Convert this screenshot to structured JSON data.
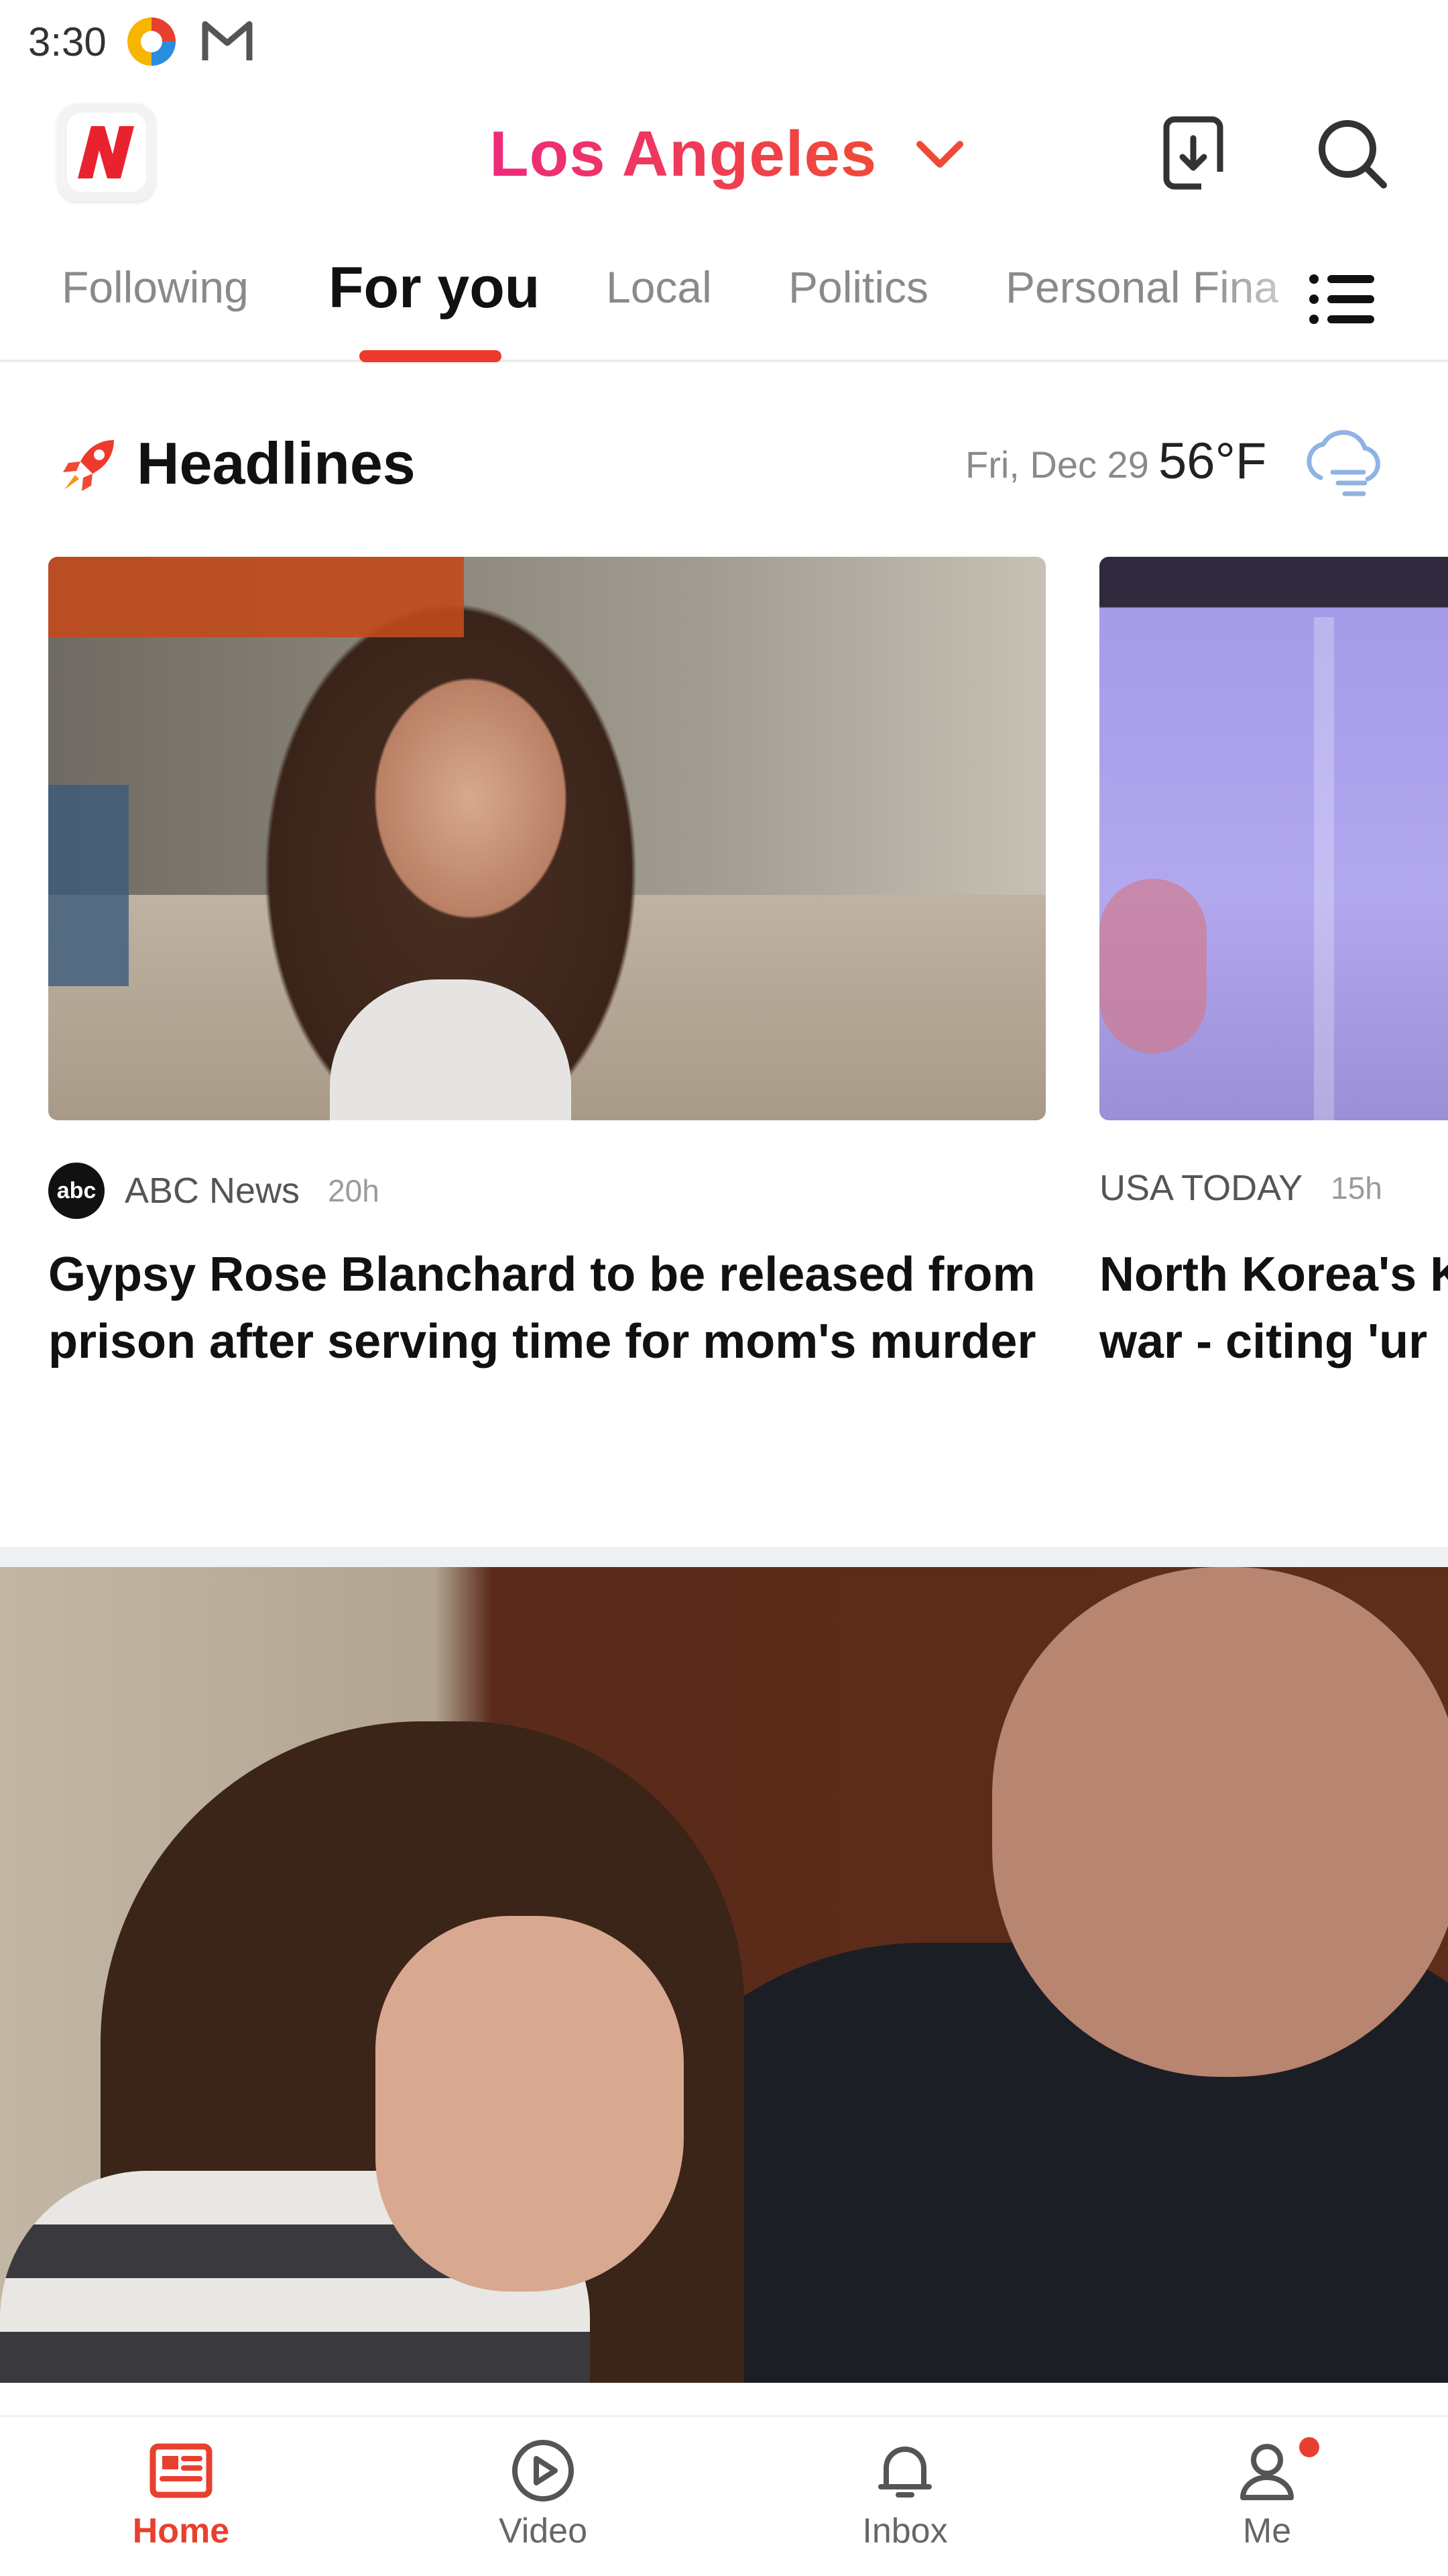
{
  "status_bar": {
    "time": "3:30",
    "icons": [
      "app-notification-icon",
      "gmail-icon"
    ]
  },
  "top_bar": {
    "logo_letter": "N",
    "location": "Los Angeles",
    "brand_color": "#ee2a7b",
    "accent_color": "#f04a36"
  },
  "tabs": {
    "items": [
      "Following",
      "For you",
      "Local",
      "Politics",
      "Personal Fina"
    ],
    "active": "For you",
    "menu_icon": "list-menu-icon"
  },
  "headlines": {
    "title": "Headlines",
    "date": "Fri, Dec 29",
    "temperature": "56°F",
    "weather_icon": "cloud-icon"
  },
  "cards": [
    {
      "source": "ABC News",
      "source_logo": "abc",
      "time": "20h",
      "title": "Gypsy Rose Blanchard to be released from prison after serving time for mom's murder"
    },
    {
      "source": "USA TODAY",
      "time": "15h",
      "title": "North Korea's K\nwar - citing 'ur"
    }
  ],
  "bottom_nav": {
    "items": [
      "Home",
      "Video",
      "Inbox",
      "Me"
    ],
    "active": "Home",
    "active_color": "#e8402f"
  }
}
